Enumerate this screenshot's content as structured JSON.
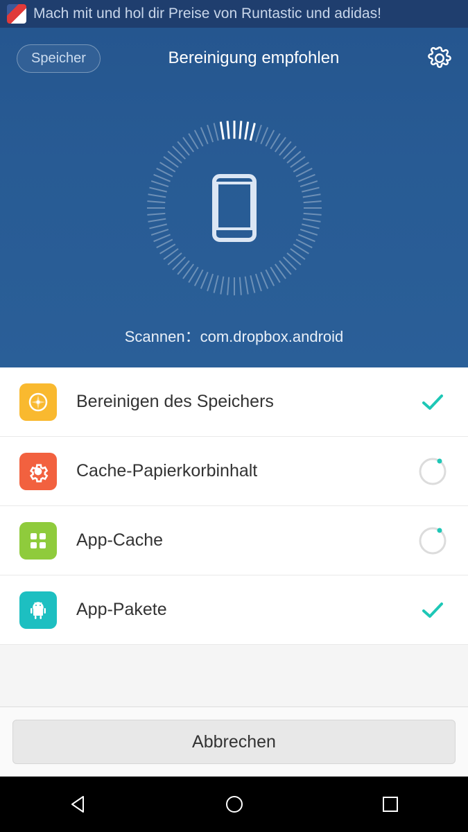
{
  "notification": {
    "text": "Mach mit und hol dir Preise von Runtastic und adidas!"
  },
  "header": {
    "speicher_label": "Speicher",
    "title": "Bereinigung empfohlen",
    "scan_prefix": "Scannen：",
    "scan_package": "com.dropbox.android"
  },
  "rows": [
    {
      "label": "Bereinigen des Speichers",
      "icon": "compass",
      "color": "#f9b92f",
      "state": "done"
    },
    {
      "label": "Cache-Papierkorbinhalt",
      "icon": "gear",
      "color": "#f2613f",
      "state": "scanning"
    },
    {
      "label": "App-Cache",
      "icon": "grid",
      "color": "#8fcb3c",
      "state": "scanning"
    },
    {
      "label": "App-Pakete",
      "icon": "android",
      "color": "#1dbfc1",
      "state": "done"
    }
  ],
  "buttons": {
    "cancel_label": "Abbrechen"
  },
  "colors": {
    "accent": "#1ec7b6",
    "header_bg": "#285b94"
  }
}
